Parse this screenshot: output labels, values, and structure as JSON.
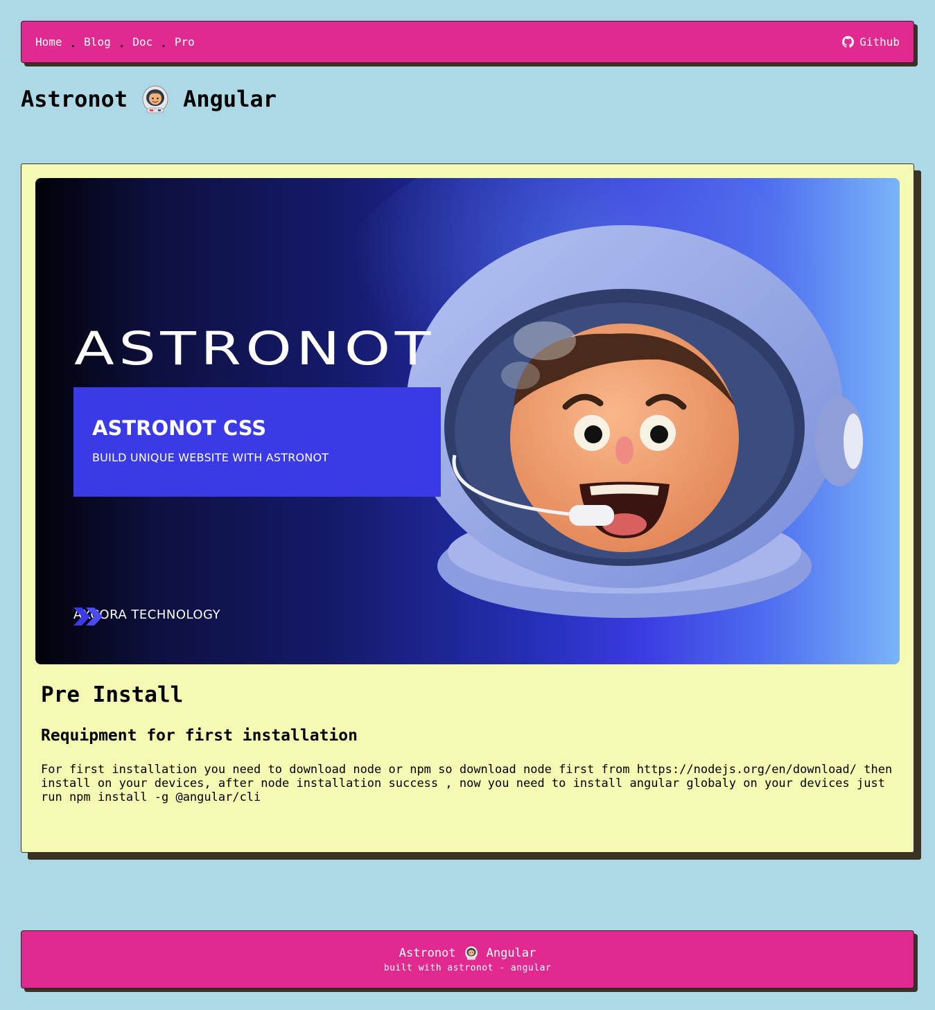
{
  "nav": {
    "links": [
      {
        "label": "Home"
      },
      {
        "label": "Blog"
      },
      {
        "label": "Doc"
      },
      {
        "label": "Pro"
      }
    ],
    "separator": ".",
    "github_label": "Github",
    "github_icon": "github-icon"
  },
  "page": {
    "title_left": "Astronot",
    "title_right": "Angular",
    "title_icon": "astronaut-emoji-icon"
  },
  "hero": {
    "wordmark": "ASTRONOT",
    "box_title": "ASTRONOT CSS",
    "box_subtitle": "BUILD UNIQUE WEBSITE WITH ASTRONOT",
    "brand": "AXCORA TECHNOLOGY",
    "brand_icon": "double-chevron-logo-icon"
  },
  "article": {
    "heading": "Pre Install",
    "subheading": "Requipment for first installation",
    "body": "For first installation you need to download node or npm so download node first from https://nodejs.org/en/download/ then install on your devices, after node installation success , now you need to install angular globaly on your devices just run npm install -g @angular/cli"
  },
  "footer": {
    "title_left": "Astronot",
    "title_right": "Angular",
    "subtitle": "built with astronot - angular"
  },
  "colors": {
    "background": "#add8e6",
    "accent": "#e02a90",
    "card": "#f4fab2",
    "shadow": "#3a3225"
  }
}
